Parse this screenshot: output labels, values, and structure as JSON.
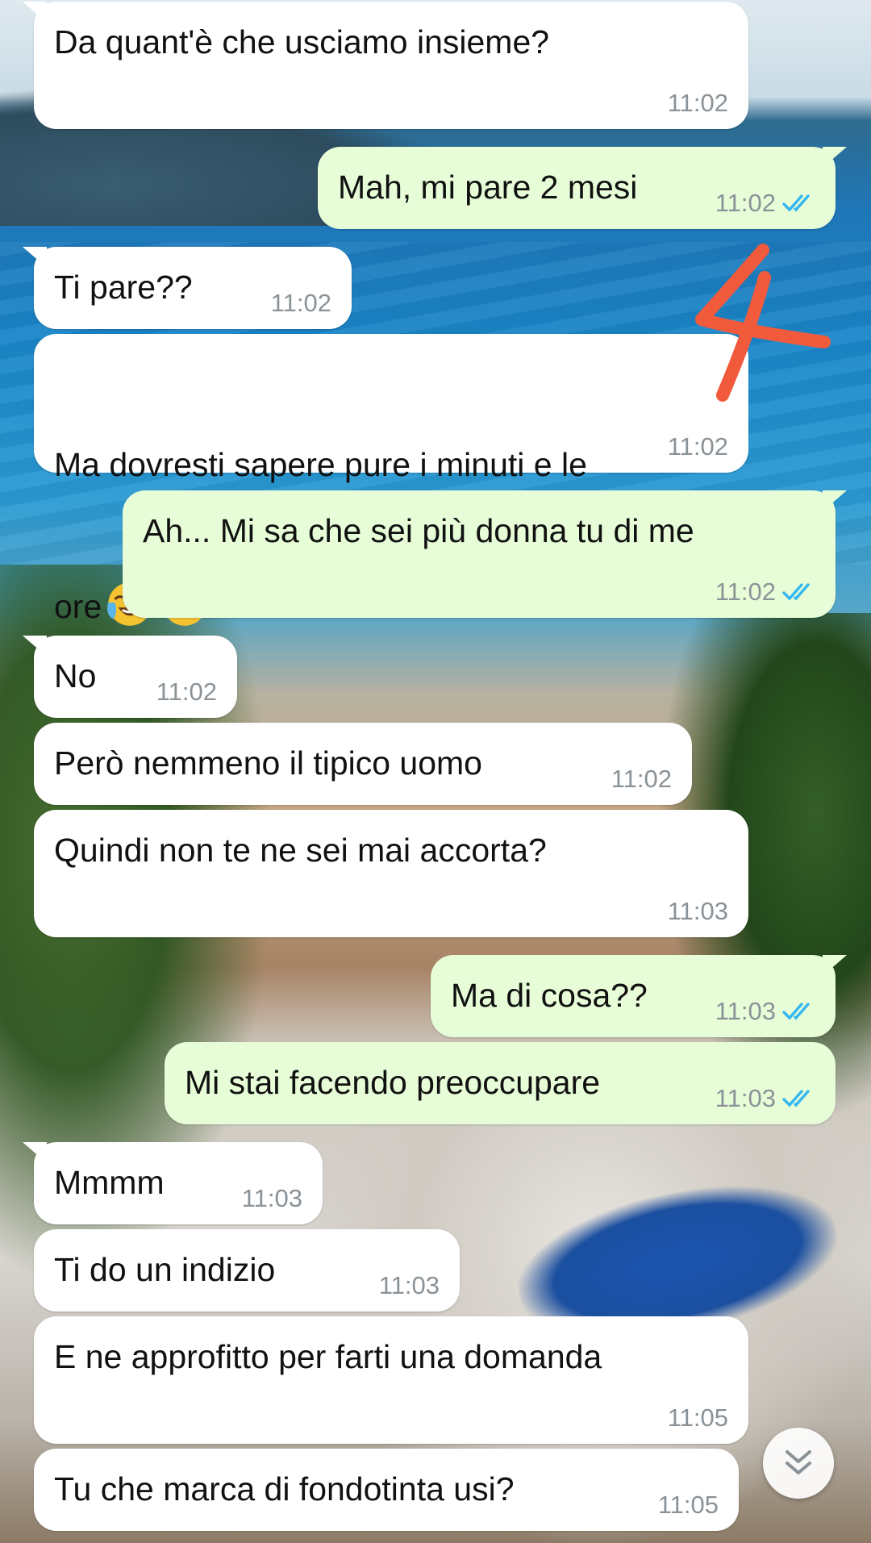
{
  "messages": [
    {
      "direction": "in",
      "text": "Da quant'è che usciamo insieme?",
      "time": "11:02"
    },
    {
      "direction": "out",
      "text": "Mah, mi pare 2 mesi",
      "time": "11:02",
      "status": "read"
    },
    {
      "direction": "in",
      "text": "Ti pare??",
      "time": "11:02"
    },
    {
      "direction": "in",
      "text": "Ma dovresti sapere pure i minuti e le",
      "text_line2": "ore",
      "emojis": [
        "face-with-tears-of-joy",
        "face-with-tears-of-joy"
      ],
      "time": "11:02"
    },
    {
      "direction": "out",
      "text": "Ah... Mi sa che sei più donna tu di me",
      "time": "11:02",
      "status": "read"
    },
    {
      "direction": "in",
      "text": "No",
      "time": "11:02"
    },
    {
      "direction": "in",
      "text": "Però nemmeno il tipico uomo",
      "time": "11:02"
    },
    {
      "direction": "in",
      "text": "Quindi non te ne sei mai accorta?",
      "time": "11:03"
    },
    {
      "direction": "out",
      "text": "Ma di cosa??",
      "time": "11:03",
      "status": "read"
    },
    {
      "direction": "out",
      "text": "Mi stai facendo preoccupare",
      "time": "11:03",
      "status": "read"
    },
    {
      "direction": "in",
      "text": "Mmmm",
      "time": "11:03"
    },
    {
      "direction": "in",
      "text": "Ti do un indizio",
      "time": "11:03"
    },
    {
      "direction": "in",
      "text": "E ne approfitto per farti una domanda",
      "time": "11:05"
    },
    {
      "direction": "in",
      "text": "Tu che marca di fondotinta usi?",
      "time": "11:05"
    }
  ],
  "annotation": {
    "text": "4",
    "color": "#f25a3c"
  },
  "colors": {
    "incoming_bubble": "#ffffff",
    "outgoing_bubble": "#e7fdd8",
    "read_ticks": "#34b7f1",
    "timestamp": "#8a9297"
  },
  "icons": {
    "scroll_down": "double-chevron-down-icon",
    "read_receipt": "double-check-icon"
  }
}
